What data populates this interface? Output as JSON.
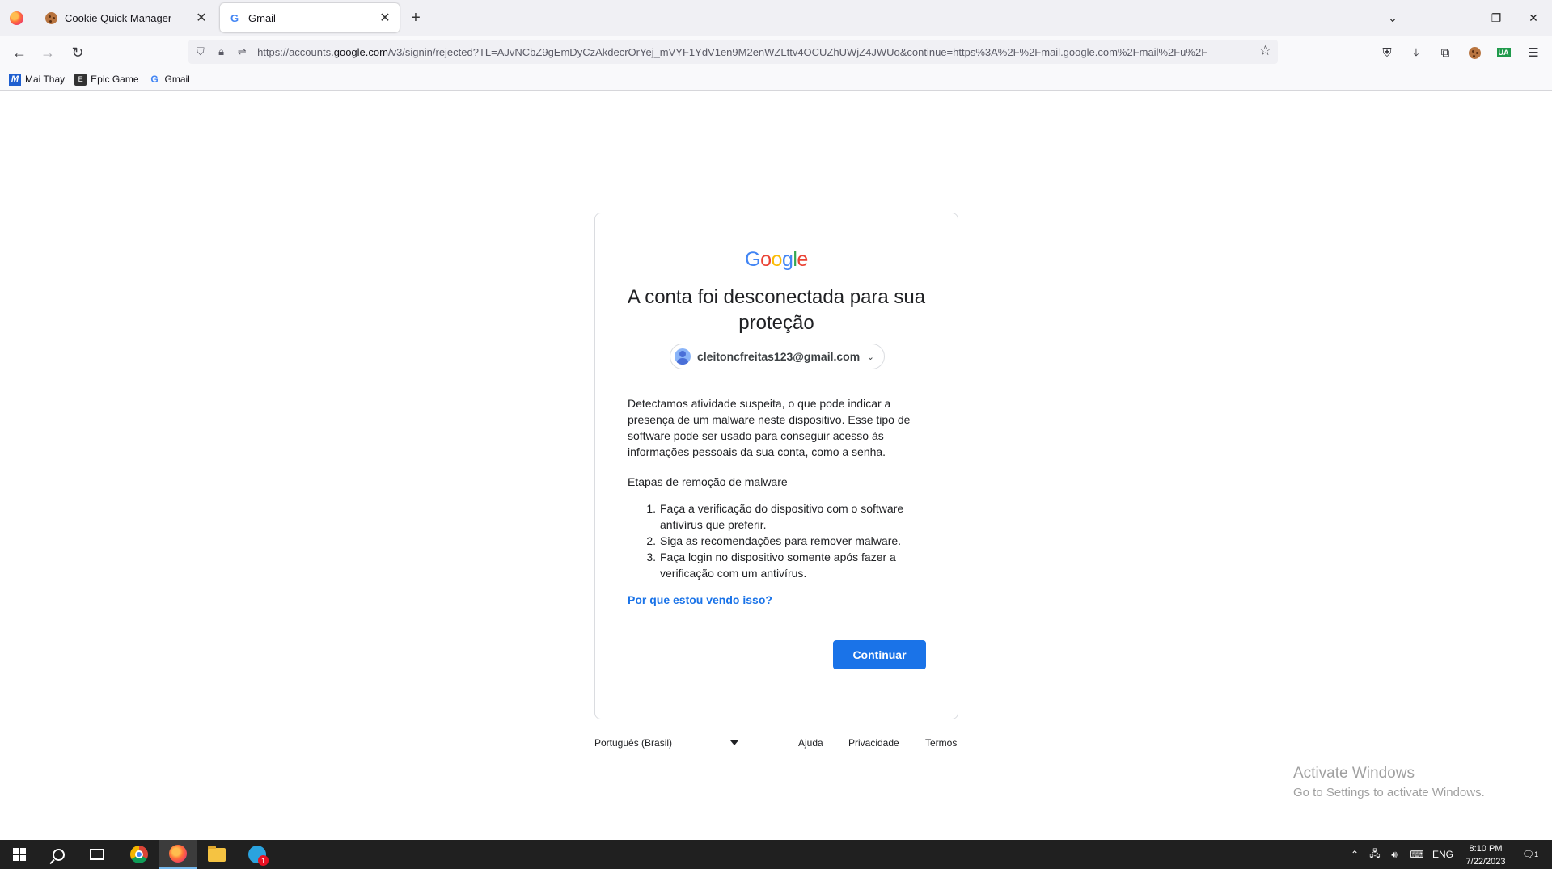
{
  "browser": {
    "tabs": [
      {
        "title": "Cookie Quick Manager",
        "favicon": "cookie-icon"
      },
      {
        "title": "Gmail",
        "favicon": "google-g-icon"
      }
    ],
    "url_prefix": "https://accounts.",
    "url_host": "google.com",
    "url_rest": "/v3/signin/rejected?TL=AJvNCbZ9gEmDyCzAkdecrOrYej_mVYF1YdV1en9M2enWZLttv4OCUZhUWjZ4JWUo&continue=https%3A%2F%2Fmail.google.com%2Fmail%2Fu%2F",
    "bookmarks": [
      {
        "label": "Mai Thay",
        "icon": "M"
      },
      {
        "label": "Epic Game",
        "icon": "E"
      },
      {
        "label": "Gmail",
        "icon": "G"
      }
    ],
    "extension_badge": "UA"
  },
  "page": {
    "logo_letters": [
      "G",
      "o",
      "o",
      "g",
      "l",
      "e"
    ],
    "headline": "A conta foi desconectada para sua proteção",
    "account_email": "cleitoncfreitas123@gmail.com",
    "body": "Detectamos atividade suspeita, o que pode indicar a presença de um malware neste dispositivo. Esse tipo de software pode ser usado para conseguir acesso às informações pessoais da sua conta, como a senha.",
    "steps_title": "Etapas de remoção de malware",
    "steps": [
      {
        "num": "1.",
        "text": "Faça a verificação do dispositivo com o software antivírus que preferir."
      },
      {
        "num": "2.",
        "text": "Siga as recomendações para remover malware."
      },
      {
        "num": "3.",
        "text": "Faça login no dispositivo somente após fazer a verificação com um antivírus."
      }
    ],
    "why_link": "Por que estou vendo isso?",
    "continue_label": "Continuar",
    "footer": {
      "language": "Português (Brasil)",
      "help": "Ajuda",
      "privacy": "Privacidade",
      "terms": "Termos"
    }
  },
  "watermark": {
    "line1": "Activate Windows",
    "line2": "Go to Settings to activate Windows."
  },
  "taskbar": {
    "telegram_badge": "1",
    "lang": "ENG",
    "time": "8:10 PM",
    "date": "7/22/2023",
    "notification_count": "1"
  },
  "colors": {
    "primary_button": "#1a73e8",
    "link": "#1a73e8"
  }
}
